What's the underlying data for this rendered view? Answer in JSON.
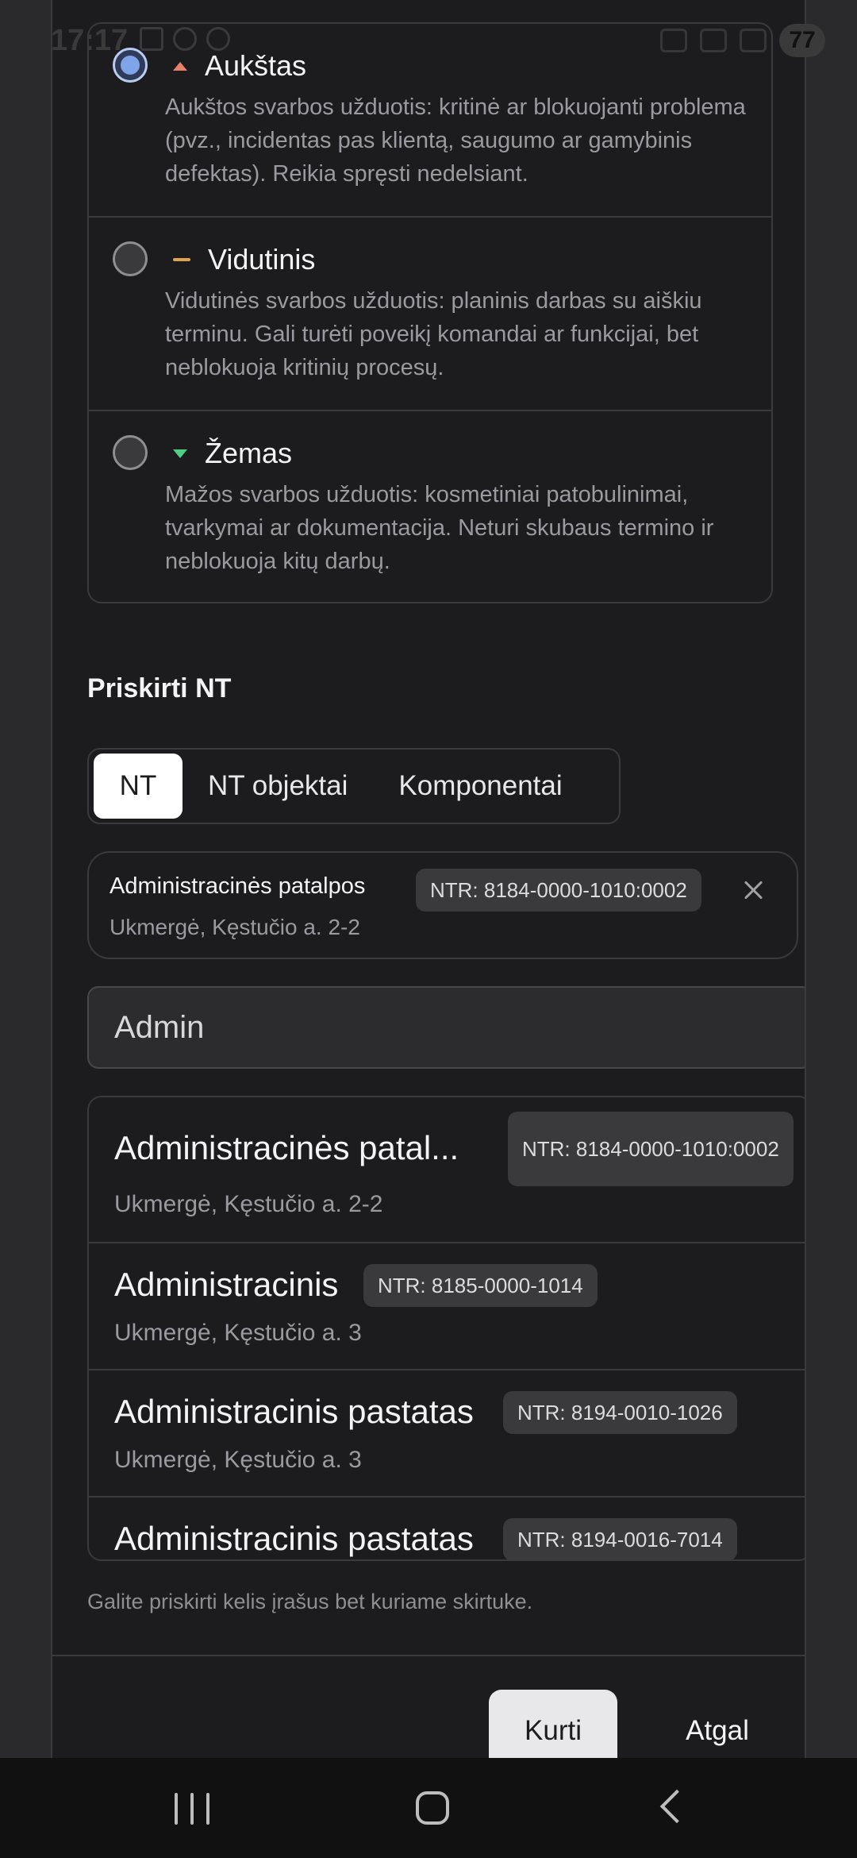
{
  "status_bar": {
    "time": "17:17",
    "battery": "77"
  },
  "priority_options": [
    {
      "title": "Aukštas",
      "description": "Aukštos svarbos užduotis: kritinė ar blokuojanti problema (pvz., incidentas pas klientą, saugumo ar gamybinis defektas). Reikia spręsti nedelsiant.",
      "selected": true,
      "icon": "arrow-up-icon",
      "color": "#e8806b"
    },
    {
      "title": "Vidutinis",
      "description": "Vidutinės svarbos užduotis: planinis darbas su aiškiu terminu. Gali turėti poveikį komandai ar funkcijai, bet neblokuoja kritinių procesų.",
      "selected": false,
      "icon": "dash-icon",
      "color": "#e0a24a"
    },
    {
      "title": "Žemas",
      "description": "Mažos svarbos užduotis: kosmetiniai patobulinimai, tvarkymai ar dokumentacija. Neturi skubaus termino ir neblokuoja kitų darbų.",
      "selected": false,
      "icon": "arrow-down-icon",
      "color": "#4fcf86"
    }
  ],
  "assign": {
    "title": "Priskirti NT",
    "tabs": [
      "NT",
      "NT objektai",
      "Komponentai"
    ],
    "active_tab": "NT",
    "selected": {
      "title": "Administracinės patalpos",
      "badge": "NTR: 8184-0000-1010:0002",
      "address": "Ukmergė, Kęstučio a. 2-2"
    },
    "search_value": "Admin",
    "results": [
      {
        "title": "Administracinės patal...",
        "badge": "NTR: 8184-0000-1010:0002",
        "address": "Ukmergė, Kęstučio a. 2-2"
      },
      {
        "title": "Administracinis",
        "badge": "NTR: 8185-0000-1014",
        "address": "Ukmergė, Kęstučio a. 3"
      },
      {
        "title": "Administracinis pastatas",
        "badge": "NTR: 8194-0010-1026",
        "address": "Ukmergė, Kęstučio a. 3"
      },
      {
        "title": "Administracinis pastatas",
        "badge": "NTR: 8194-0016-7014",
        "address": ""
      }
    ],
    "hint": "Galite priskirti kelis įrašus bet kuriame skirtuke."
  },
  "footer": {
    "create_label": "Kurti",
    "back_label": "Atgal"
  },
  "colors": {
    "background": "#1c1c1e",
    "accent_radio": "#7fa4e8",
    "high": "#e8806b",
    "medium": "#e0a24a",
    "low": "#4fcf86"
  }
}
